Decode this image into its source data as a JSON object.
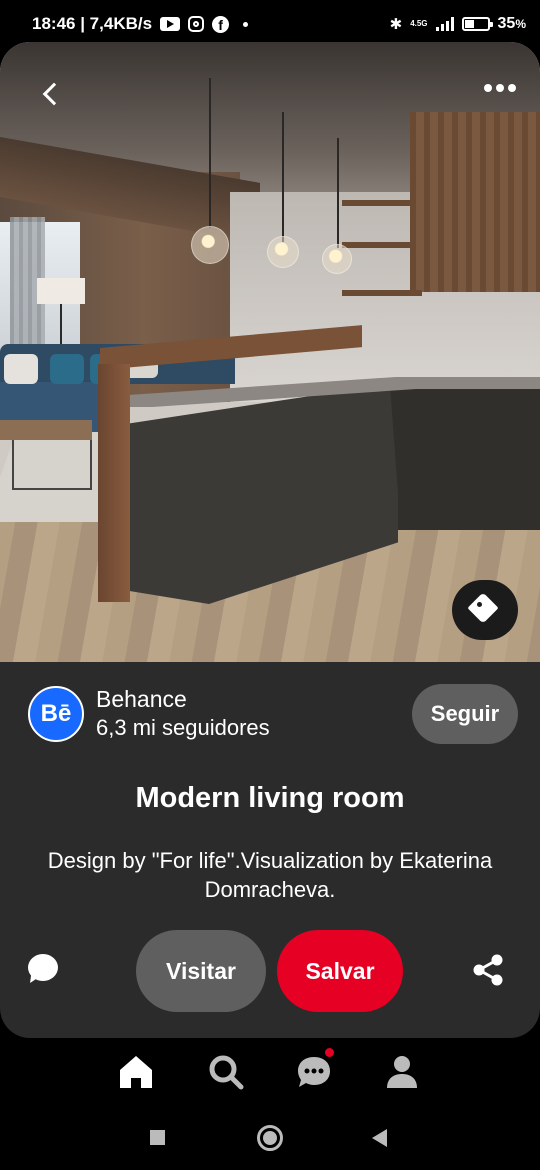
{
  "status_bar": {
    "time_speed": "18:46 | 7,4KB/s",
    "network": "4.5G",
    "battery": "35",
    "battery_unit": "%"
  },
  "pin": {
    "creator": {
      "name": "Behance",
      "avatar_text": "Bē",
      "followers": "6,3 mi seguidores",
      "follow_label": "Seguir"
    },
    "title": "Modern living room",
    "description": "Design by \"For life\".Visualization by Ekaterina Domracheva.",
    "actions": {
      "visit_label": "Visitar",
      "save_label": "Salvar"
    }
  },
  "colors": {
    "save": "#e60023",
    "card_bg": "#2b2b2b",
    "secondary_button": "#5f5f5f",
    "behance_blue": "#1769ff"
  },
  "icons": {
    "back": "chevron-left-icon",
    "more": "more-horizontal-icon",
    "tag": "tag-icon",
    "comment": "comment-icon",
    "share": "share-icon",
    "nav": [
      "home-icon",
      "search-icon",
      "messages-icon",
      "profile-icon"
    ]
  }
}
